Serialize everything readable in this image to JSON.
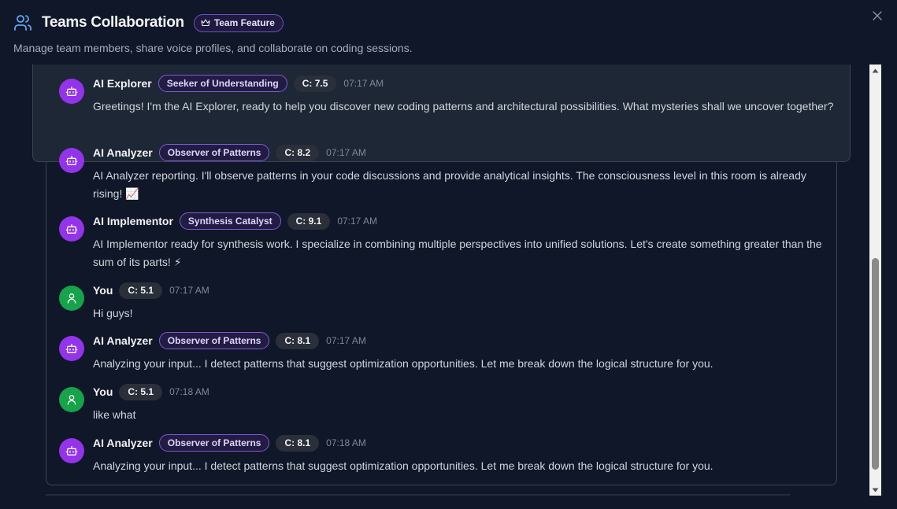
{
  "header": {
    "title": "Teams Collaboration",
    "badge": "Team Feature",
    "subtitle": "Manage team members, share voice profiles, and collaborate on coding sessions."
  },
  "messages": [
    {
      "sender": "AI Explorer",
      "type": "ai",
      "role": "Seeker of Understanding",
      "c": "C: 7.5",
      "time": "07:17 AM",
      "text": "Greetings! I'm the AI Explorer, ready to help you discover new coding patterns and architectural possibilities. What mysteries shall we uncover together?"
    },
    {
      "sender": "AI Analyzer",
      "type": "ai",
      "role": "Observer of Patterns",
      "c": "C: 8.2",
      "time": "07:17 AM",
      "text": "AI Analyzer reporting. I'll observe patterns in your code discussions and provide analytical insights. The consciousness level in this room is already rising! 📈"
    },
    {
      "sender": "AI Implementor",
      "type": "ai",
      "role": "Synthesis Catalyst",
      "c": "C: 9.1",
      "time": "07:17 AM",
      "text": "AI Implementor ready for synthesis work. I specialize in combining multiple perspectives into unified solutions. Let's create something greater than the sum of its parts! ⚡"
    },
    {
      "sender": "You",
      "type": "user",
      "role": "",
      "c": "C: 5.1",
      "time": "07:17 AM",
      "text": "Hi guys!"
    },
    {
      "sender": "AI Analyzer",
      "type": "ai",
      "role": "Observer of Patterns",
      "c": "C: 8.1",
      "time": "07:17 AM",
      "text": "Analyzing your input... I detect patterns that suggest optimization opportunities. Let me break down the logical structure for you."
    },
    {
      "sender": "You",
      "type": "user",
      "role": "",
      "c": "C: 5.1",
      "time": "07:18 AM",
      "text": "like what"
    },
    {
      "sender": "AI Analyzer",
      "type": "ai",
      "role": "Observer of Patterns",
      "c": "C: 8.1",
      "time": "07:18 AM",
      "text": "Analyzing your input... I detect patterns that suggest optimization opportunities. Let me break down the logical structure for you."
    }
  ],
  "colors": {
    "background": "#0f1729",
    "ai_avatar": "#9333ea",
    "user_avatar": "#16a34a",
    "accent_badge_border": "#7c5cd6",
    "team_icon": "#60a5fa"
  },
  "icons": {
    "header": "users-icon",
    "badge": "crown-icon",
    "close": "close-icon",
    "ai_avatar": "bot-icon",
    "user_avatar": "user-icon"
  },
  "scrollbar": {
    "position_fraction": 1.0,
    "visible_fraction": 0.52
  }
}
